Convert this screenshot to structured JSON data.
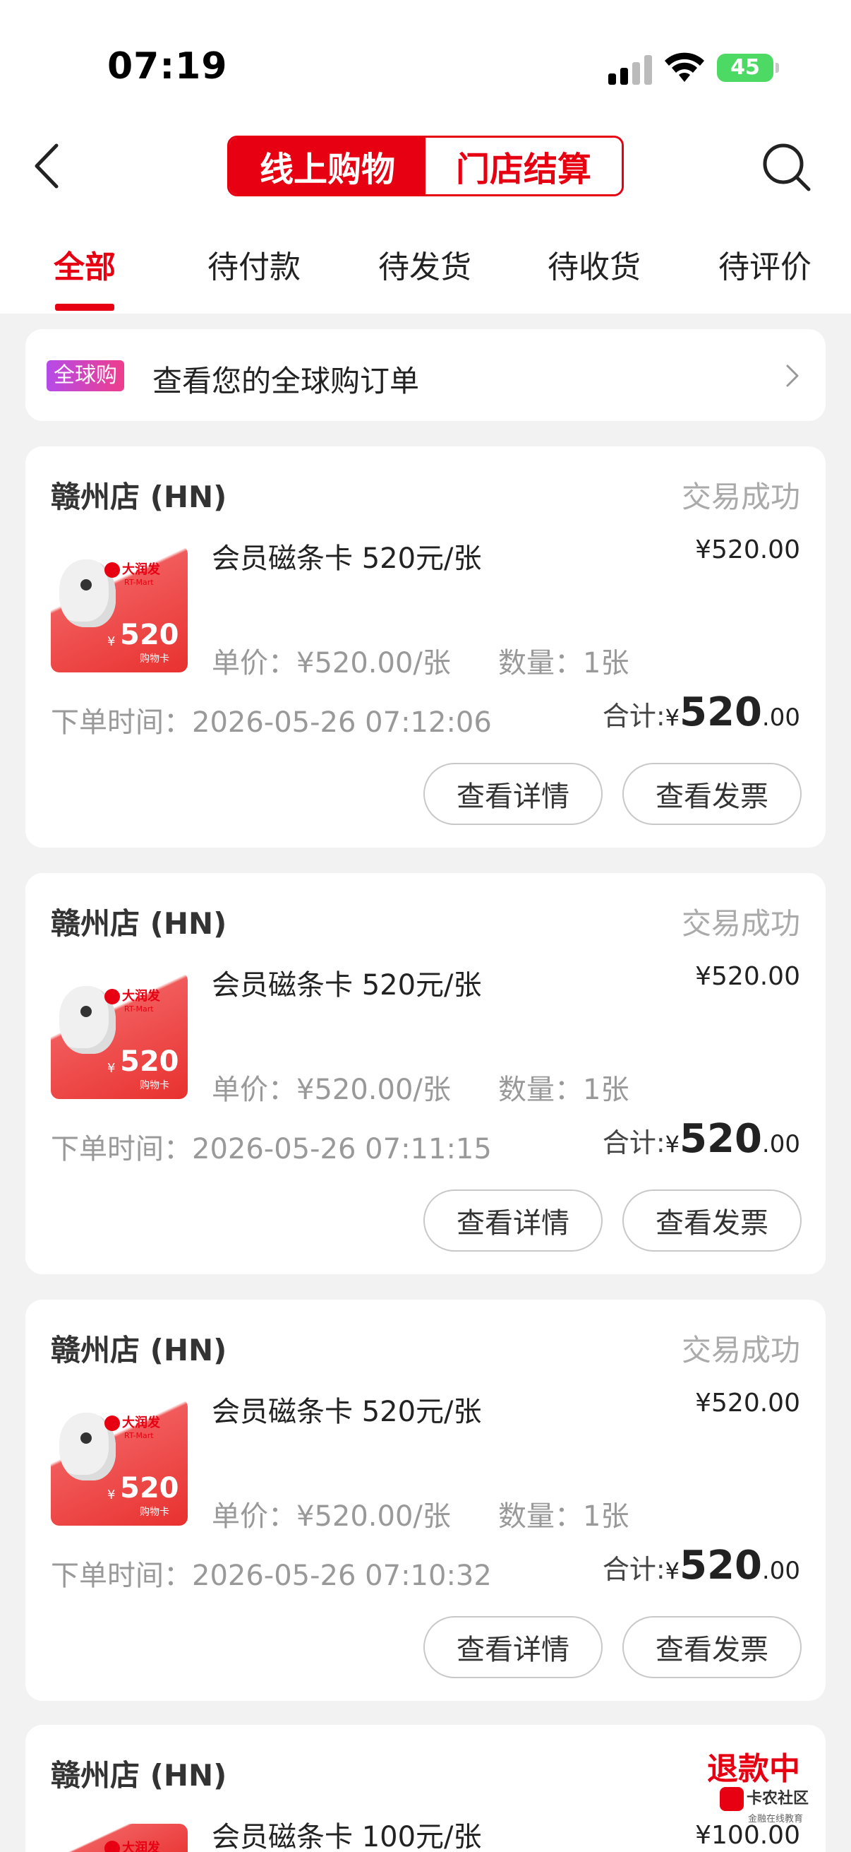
{
  "status_bar": {
    "time": "07:19",
    "battery": "45"
  },
  "header": {
    "segment_online": "线上购物",
    "segment_store": "门店结算"
  },
  "tabs": [
    "全部",
    "待付款",
    "待发货",
    "待收货",
    "待评价"
  ],
  "global_banner": {
    "badge": "全球购",
    "text": "查看您的全球购订单"
  },
  "thumbnail": {
    "brand": "大润发",
    "brand_en": "RT-Mart",
    "currency": "¥",
    "amount": "520",
    "caption": "购物卡"
  },
  "orders": [
    {
      "store": "赣州店 (HN)",
      "status": "交易成功",
      "product": "会员磁条卡 520元/张",
      "price": "¥520.00",
      "unit_price": "单价：¥520.00/张",
      "quantity": "数量：1张",
      "order_time": "下单时间：2026-05-26 07:12:06",
      "total_label": "合计:",
      "total_currency": "¥",
      "total_int": "520",
      "total_dec": ".00",
      "btn_detail": "查看详情",
      "btn_invoice": "查看发票"
    },
    {
      "store": "赣州店 (HN)",
      "status": "交易成功",
      "product": "会员磁条卡 520元/张",
      "price": "¥520.00",
      "unit_price": "单价：¥520.00/张",
      "quantity": "数量：1张",
      "order_time": "下单时间：2026-05-26 07:11:15",
      "total_label": "合计:",
      "total_currency": "¥",
      "total_int": "520",
      "total_dec": ".00",
      "btn_detail": "查看详情",
      "btn_invoice": "查看发票"
    },
    {
      "store": "赣州店 (HN)",
      "status": "交易成功",
      "product": "会员磁条卡 520元/张",
      "price": "¥520.00",
      "unit_price": "单价：¥520.00/张",
      "quantity": "数量：1张",
      "order_time": "下单时间：2026-05-26 07:10:32",
      "total_label": "合计:",
      "total_currency": "¥",
      "total_int": "520",
      "total_dec": ".00",
      "btn_detail": "查看详情",
      "btn_invoice": "查看发票"
    },
    {
      "store": "赣州店 (HN)",
      "status": "退款中",
      "product": "会员磁条卡 100元/张",
      "price": "¥100.00"
    }
  ],
  "watermark": {
    "title": "卡农社区",
    "subtitle": "金融在线教育"
  },
  "colors": {
    "accent": "#e60012",
    "background": "#f2f2f2"
  }
}
